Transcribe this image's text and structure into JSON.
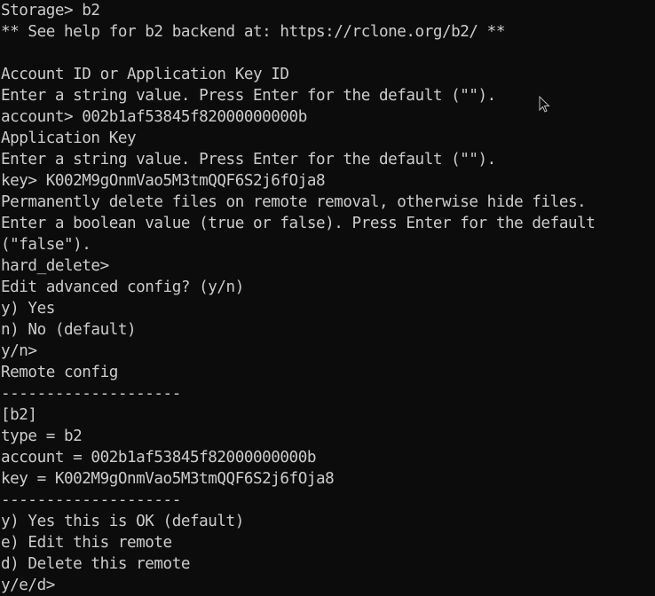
{
  "terminal": {
    "lines": [
      "Storage> b2",
      "** See help for b2 backend at: https://rclone.org/b2/ **",
      "",
      "Account ID or Application Key ID",
      "Enter a string value. Press Enter for the default (\"\").",
      "account> 002b1af53845f82000000000b",
      "Application Key",
      "Enter a string value. Press Enter for the default (\"\").",
      "key> K002M9gOnmVao5M3tmQQF6S2j6fOja8",
      "Permanently delete files on remote removal, otherwise hide files.",
      "Enter a boolean value (true or false). Press Enter for the default",
      "(\"false\").",
      "hard_delete>",
      "Edit advanced config? (y/n)",
      "y) Yes",
      "n) No (default)",
      "y/n>",
      "Remote config",
      "--------------------",
      "[b2]",
      "type = b2",
      "account = 002b1af53845f82000000000b",
      "key = K002M9gOnmVao5M3tmQQF6S2j6fOja8",
      "--------------------",
      "y) Yes this is OK (default)",
      "e) Edit this remote",
      "d) Delete this remote",
      "y/e/d>"
    ]
  },
  "colors": {
    "background": "#0c0c0c",
    "foreground": "#cccccc"
  },
  "icons": {
    "mouse_cursor": "arrow-pointer-icon"
  }
}
